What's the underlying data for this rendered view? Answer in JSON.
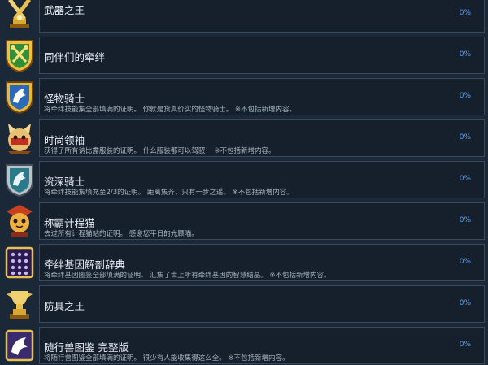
{
  "achievements": [
    {
      "icon": "crossed-swords-trophy-icon",
      "title": "武器之王",
      "desc": "",
      "percent": "0%"
    },
    {
      "icon": "crossed-keys-shield-icon",
      "title": "同伴们的牵绊",
      "desc": "",
      "percent": "0%"
    },
    {
      "icon": "monster-rider-shield-icon",
      "title": "怪物骑士",
      "desc": "将牵绊技能集全部填满的证明。 你就是货真价实的怪物骑士。 ※不包括新增内容。",
      "percent": "0%"
    },
    {
      "icon": "felyne-mascot-icon",
      "title": "时尚领袖",
      "desc": "获得了所有讷比露服装的证明。 什么服装都可以驾驭！ ※不包括新增内容。",
      "percent": "0%"
    },
    {
      "icon": "veteran-rider-shield-icon",
      "title": "资深骑士",
      "desc": "将牵绊技能集填充至2/3的证明。 距离集齐，只有一步之遥。 ※不包括新增内容。",
      "percent": "0%"
    },
    {
      "icon": "program-cat-icon",
      "title": "称霸计程猫",
      "desc": "去过所有计程猫站的证明。 感谢您平日的光顾喵。",
      "percent": "0%"
    },
    {
      "icon": "gene-grid-book-icon",
      "title": "牵绊基因解剖辞典",
      "desc": "将牵绊基因图鉴全部填满的证明。 汇集了世上所有牵绊基因的智慧结晶。 ※不包括新增内容。",
      "percent": "0%"
    },
    {
      "icon": "armor-trophy-icon",
      "title": "防具之王",
      "desc": "",
      "percent": "0%"
    },
    {
      "icon": "monsterpedia-book-icon",
      "title": "随行兽图鉴 完整版",
      "desc": "将随行兽图鉴全部填满的证明。 很少有人能收集得这么全。 ※不包括新增内容。",
      "percent": "0%"
    }
  ],
  "colors": {
    "background": "#1b2838",
    "card": "#16202d",
    "border": "#3a4a5c",
    "percent": "#4fa3ff",
    "gold": "#d8a830"
  }
}
